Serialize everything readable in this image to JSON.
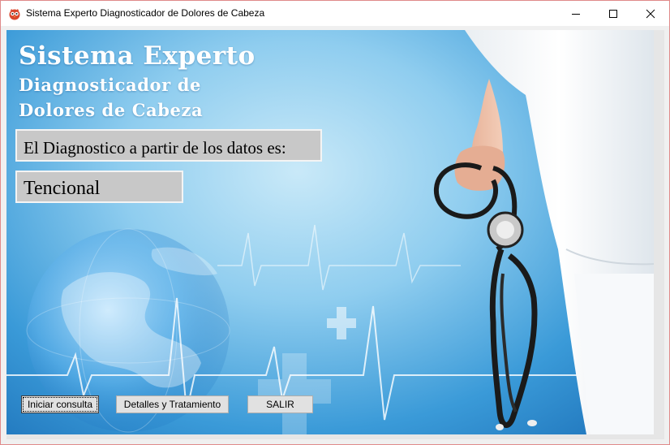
{
  "window": {
    "title": "Sistema Experto Diagnosticador de Dolores de Cabeza",
    "controls": [
      "minimize",
      "maximize",
      "close"
    ]
  },
  "header": {
    "line1": "Sistema Experto",
    "line2": "Diagnosticador de",
    "line3": "Dolores de Cabeza"
  },
  "diagnosis": {
    "prompt": "El Diagnostico a partir de los datos es:",
    "result": "Tencional"
  },
  "buttons": {
    "start": "Iniciar consulta",
    "details": "Detalles y Tratamiento",
    "exit": "SALIR"
  },
  "colors": {
    "background_top": "#c9e9f8",
    "background_bottom": "#1b6fb7",
    "label_box": "#c8c8c8",
    "heading": "#ffffff"
  },
  "icons": [
    "app-owl-icon",
    "minimize-icon",
    "maximize-icon",
    "close-icon"
  ]
}
